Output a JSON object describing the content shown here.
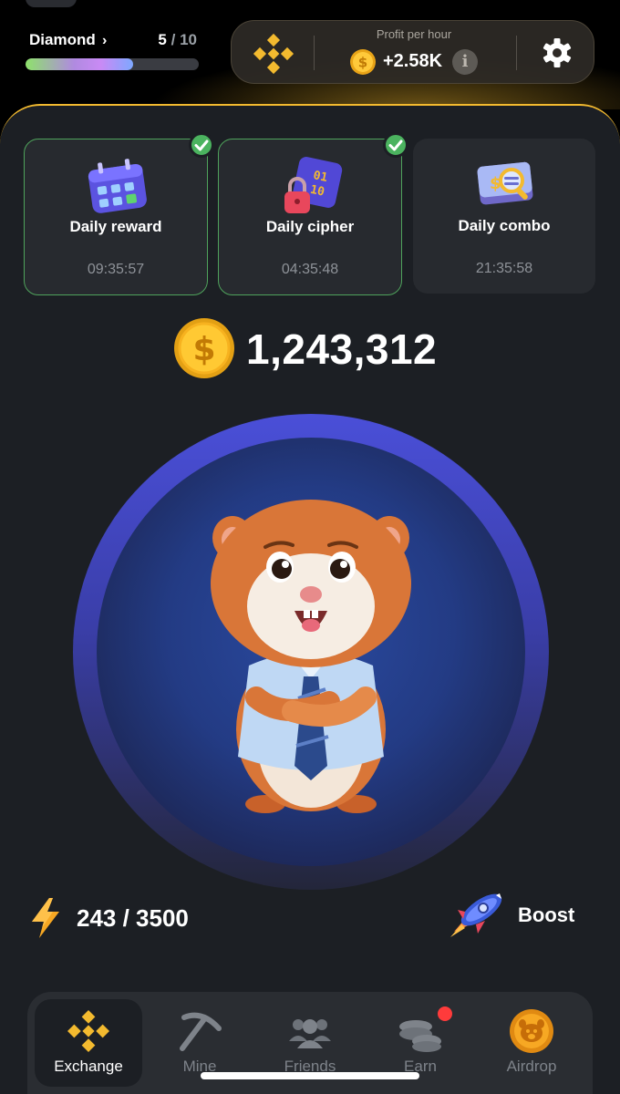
{
  "header": {
    "level_name": "Diamond",
    "level_current": "5",
    "level_total": "10",
    "level_progress": 0.62,
    "profit_label": "Profit per hour",
    "profit_value": "+2.58K"
  },
  "daily": [
    {
      "title": "Daily reward",
      "timer": "09:35:57",
      "completed": true,
      "icon": "calendar-icon"
    },
    {
      "title": "Daily cipher",
      "timer": "04:35:48",
      "completed": true,
      "icon": "cipher-lock-icon"
    },
    {
      "title": "Daily combo",
      "timer": "21:35:58",
      "completed": false,
      "icon": "combo-magnifier-icon"
    }
  ],
  "balance": "1,243,312",
  "energy": {
    "current": "243",
    "max": "3500",
    "display": "243 / 3500"
  },
  "boost_label": "Boost",
  "nav": [
    {
      "label": "Exchange",
      "icon": "binance-icon",
      "active": true
    },
    {
      "label": "Mine",
      "icon": "pickaxe-icon",
      "active": false
    },
    {
      "label": "Friends",
      "icon": "friends-icon",
      "active": false
    },
    {
      "label": "Earn",
      "icon": "coins-icon",
      "active": false,
      "notification": true
    },
    {
      "label": "Airdrop",
      "icon": "hamster-coin-icon",
      "active": false
    }
  ],
  "colors": {
    "accent": "#f3ba2f",
    "panel": "#1c1f24",
    "success": "#4bb35f",
    "tap_ring": "#4a4fd8"
  }
}
